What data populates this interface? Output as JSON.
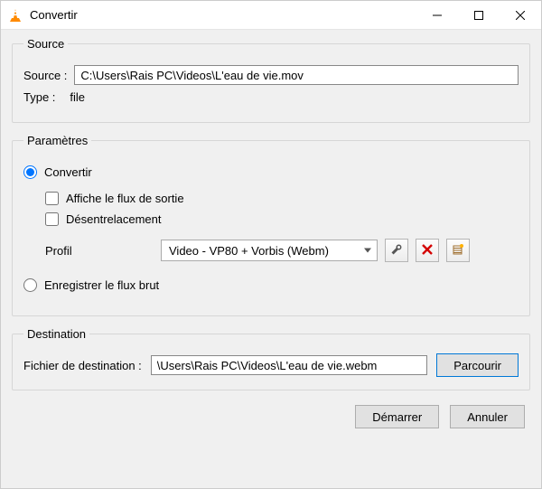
{
  "window": {
    "title": "Convertir"
  },
  "source": {
    "legend": "Source",
    "label": "Source :",
    "value": "C:\\Users\\Rais PC\\Videos\\L'eau de vie.mov",
    "type_label": "Type :",
    "type_value": "file"
  },
  "params": {
    "legend": "Paramètres",
    "convert_label": "Convertir",
    "show_output_label": "Affiche le flux de sortie",
    "deinterlace_label": "Désentrelacement",
    "profile_label": "Profil",
    "profile_value": "Video - VP80 + Vorbis (Webm)",
    "dump_raw_label": "Enregistrer le flux brut"
  },
  "destination": {
    "legend": "Destination",
    "label": "Fichier de destination :",
    "value": "\\Users\\Rais PC\\Videos\\L'eau de vie.webm",
    "browse": "Parcourir"
  },
  "buttons": {
    "start": "Démarrer",
    "cancel": "Annuler"
  }
}
